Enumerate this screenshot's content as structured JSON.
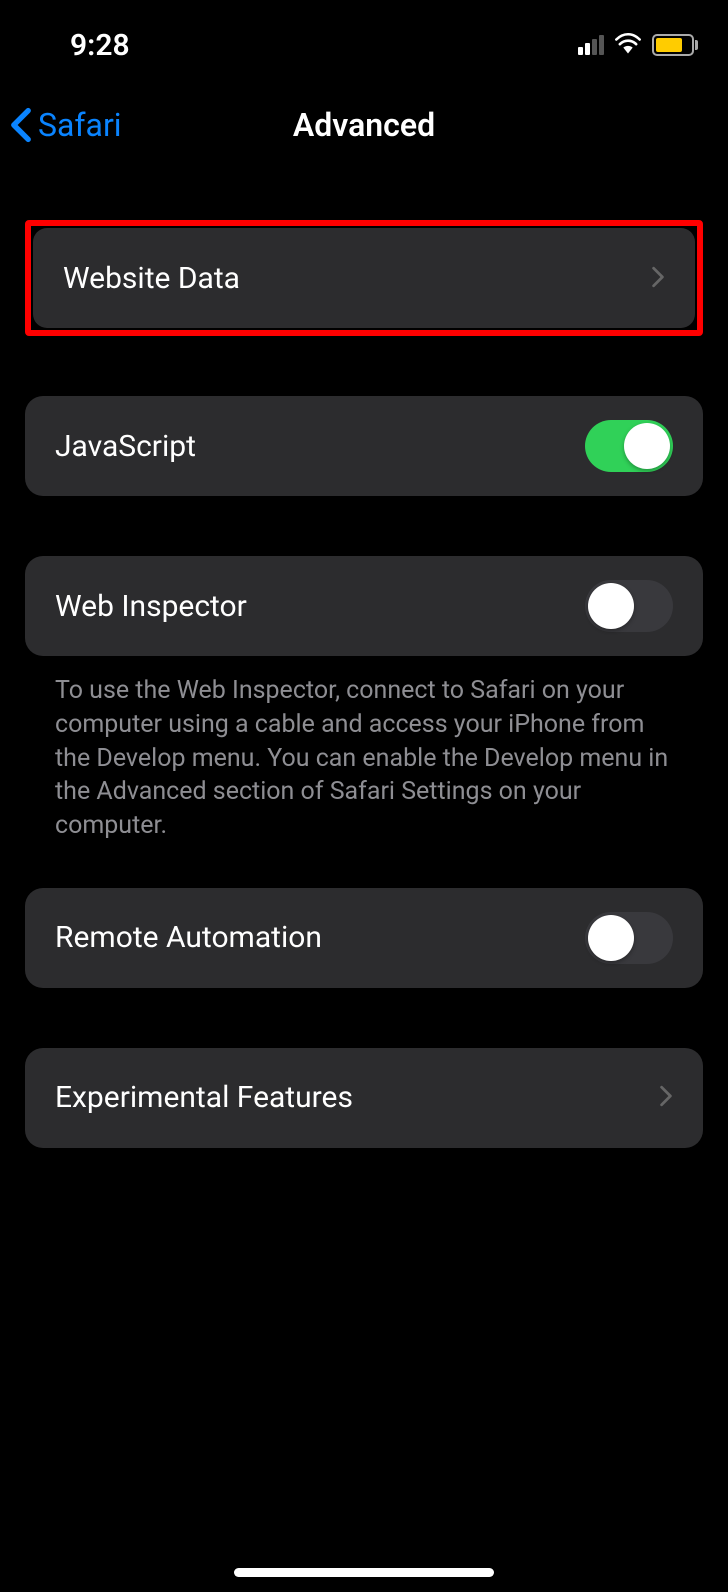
{
  "status": {
    "time": "9:28"
  },
  "nav": {
    "back_label": "Safari",
    "title": "Advanced"
  },
  "settings": {
    "website_data": {
      "label": "Website Data"
    },
    "javascript": {
      "label": "JavaScript",
      "enabled": true
    },
    "web_inspector": {
      "label": "Web Inspector",
      "enabled": false,
      "footer": "To use the Web Inspector, connect to Safari on your computer using a cable and access your iPhone from the Develop menu. You can enable the Develop menu in the Advanced section of Safari Settings on your computer."
    },
    "remote_automation": {
      "label": "Remote Automation",
      "enabled": false
    },
    "experimental_features": {
      "label": "Experimental Features"
    }
  }
}
